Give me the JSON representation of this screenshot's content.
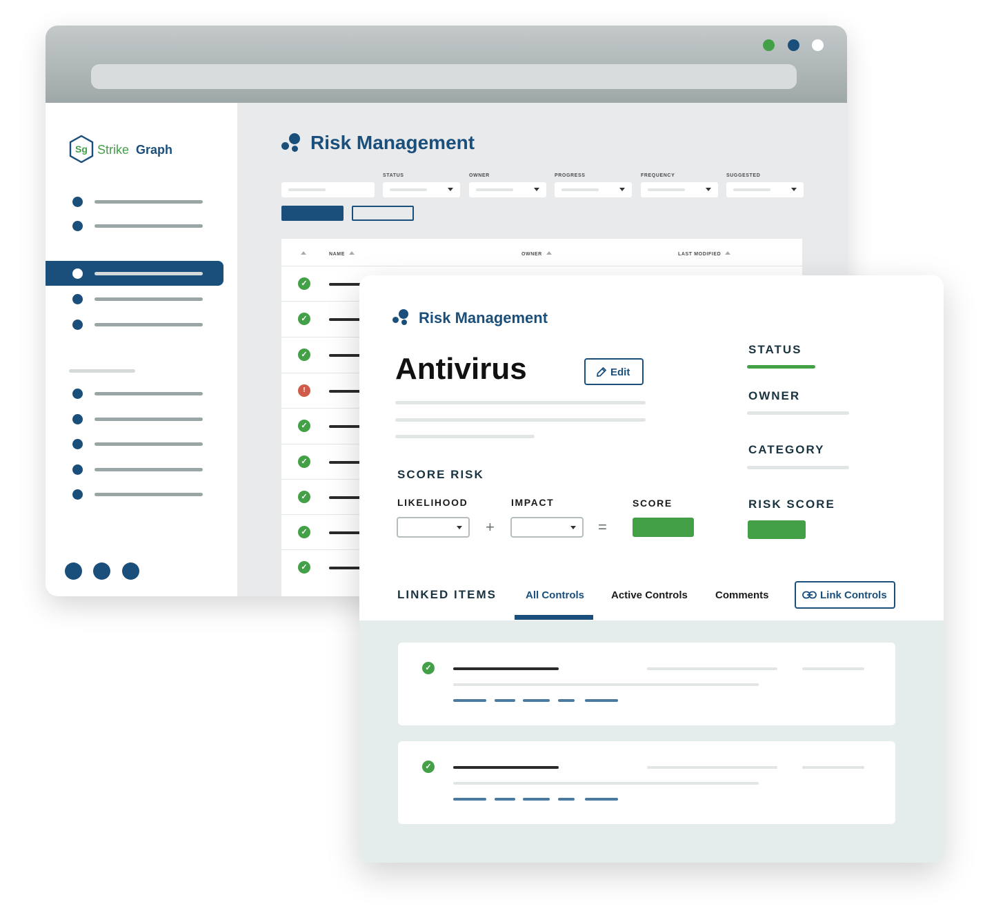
{
  "window": {
    "dots": [
      {
        "color": "#43a047"
      },
      {
        "color": "#1a4f7c"
      },
      {
        "color": "#ffffff"
      }
    ]
  },
  "brand": {
    "mark": "Sg",
    "name_first": "Strike",
    "name_second": "Graph",
    "accent": "#1a4f7c",
    "green": "#43a047"
  },
  "list_page": {
    "title": "Risk Management",
    "filters": [
      "STATUS",
      "OWNER",
      "PROGRESS",
      "FREQUENCY",
      "SUGGESTED"
    ],
    "columns": [
      "NAME",
      "OWNER",
      "LAST MODIFIED"
    ],
    "rows": [
      {
        "status": "ok"
      },
      {
        "status": "ok"
      },
      {
        "status": "ok"
      },
      {
        "status": "error"
      },
      {
        "status": "ok"
      },
      {
        "status": "ok"
      },
      {
        "status": "ok"
      },
      {
        "status": "ok"
      },
      {
        "status": "ok"
      }
    ]
  },
  "detail": {
    "breadcrumb": "Risk Management",
    "title": "Antivirus",
    "edit_label": "Edit",
    "status_label": "STATUS",
    "owner_label": "OWNER",
    "category_label": "CATEGORY",
    "risk_score_label": "RISK SCORE",
    "score_risk_label": "SCORE RISK",
    "likelihood_label": "LIKELIHOOD",
    "impact_label": "IMPACT",
    "score_label": "SCORE",
    "plus": "+",
    "equals": "=",
    "linked_items_label": "LINKED ITEMS",
    "tabs": [
      "All Controls",
      "Active Controls",
      "Comments"
    ],
    "active_tab": "All Controls",
    "link_controls_label": "Link Controls",
    "linked_items": [
      {
        "status": "ok"
      },
      {
        "status": "ok"
      }
    ]
  }
}
